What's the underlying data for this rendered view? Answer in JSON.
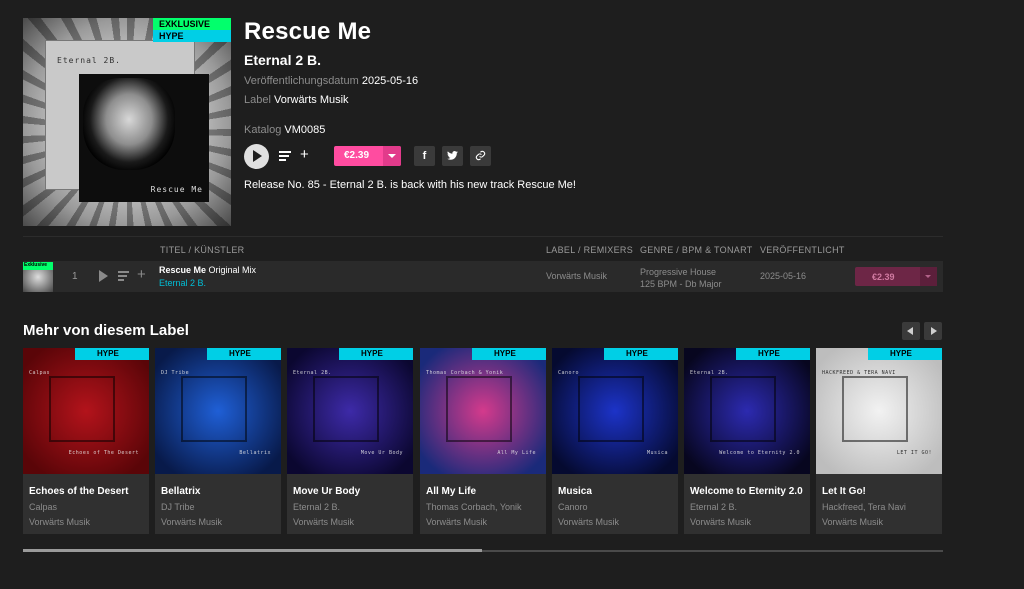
{
  "release": {
    "title": "Rescue Me",
    "artist": "Eternal 2 B.",
    "badges": {
      "exclusive": "EXKLUSIVE",
      "hype": "HYPE"
    },
    "cover_text": {
      "artist": "Eternal 2B.",
      "title": "Rescue Me"
    },
    "release_date_label": "Veröffentlichungsdatum",
    "release_date": "2025-05-16",
    "label_label": "Label",
    "label": "Vorwärts Musik",
    "catalog_label": "Katalog",
    "catalog": "VM0085",
    "price": "€2.39",
    "description": "Release No. 85 - Eternal 2 B. is back with his new track Rescue Me!",
    "social": {
      "facebook": "f",
      "twitter": "t"
    }
  },
  "track_table": {
    "headers": {
      "title_artist": "TITEL / KÜNSTLER",
      "label_remixers": "LABEL / REMIXERS",
      "genre_bpm_key": "GENRE / BPM & TONART",
      "released": "VERÖFFENTLICHT"
    },
    "rows": [
      {
        "badge": "Exklusive",
        "number": "1",
        "title": "Rescue Me",
        "mix": "Original Mix",
        "artist": "Eternal 2 B.",
        "label": "Vorwärts Musik",
        "genre": "Progressive House",
        "bpm_key": "125 BPM - Db Major",
        "date": "2025-05-16",
        "price": "€2.39"
      }
    ]
  },
  "more_from_label": {
    "title": "Mehr von diesem Label",
    "cards": [
      {
        "title": "Echoes of the Desert",
        "artist": "Calpas",
        "label": "Vorwärts Musik",
        "badge": "HYPE",
        "art_text_top": "Calpas",
        "art_text_bottom": "Echoes of The Desert",
        "colors": [
          "#b3131b",
          "#5a0508"
        ]
      },
      {
        "title": "Bellatrix",
        "artist": "DJ Tribe",
        "label": "Vorwärts Musik",
        "badge": "HYPE",
        "art_text_top": "DJ Tribe",
        "art_text_bottom": "Bellatrix",
        "colors": [
          "#1f5fd6",
          "#081a4a"
        ]
      },
      {
        "title": "Move Ur Body",
        "artist": "Eternal 2 B.",
        "label": "Vorwärts Musik",
        "badge": "HYPE",
        "art_text_top": "Eternal 2B.",
        "art_text_bottom": "Move Ur Body",
        "colors": [
          "#3d2aa8",
          "#0b0730"
        ]
      },
      {
        "title": "All My Life",
        "artist": "Thomas Corbach, Yonik",
        "label": "Vorwärts Musik",
        "badge": "HYPE",
        "art_text_top": "Thomas Corbach & Yonik",
        "art_text_bottom": "All My Life",
        "colors": [
          "#d43a8c",
          "#1a2a7a"
        ]
      },
      {
        "title": "Musica",
        "artist": "Canoro",
        "label": "Vorwärts Musik",
        "badge": "HYPE",
        "art_text_top": "Canoro",
        "art_text_bottom": "Musica",
        "colors": [
          "#1c33c8",
          "#050a30"
        ]
      },
      {
        "title": "Welcome to Eternity 2.0",
        "artist": "Eternal 2 B.",
        "label": "Vorwärts Musik",
        "badge": "HYPE",
        "art_text_top": "Eternal 2B.",
        "art_text_bottom": "Welcome to Eternity 2.0",
        "colors": [
          "#2c2ab0",
          "#07061f"
        ]
      },
      {
        "title": "Let It Go!",
        "artist": "Hackfreed, Tera Navi",
        "label": "Vorwärts Musik",
        "badge": "HYPE",
        "art_text_top": "HACKFREED & TERA NAVI",
        "art_text_bottom": "LET IT GO!",
        "colors": [
          "#f2f2f2",
          "#bdbdbd"
        ]
      }
    ]
  },
  "colors": {
    "accent_pink": "#ff4ca0",
    "accent_cyan": "#00cfe6",
    "accent_green": "#02ff6c",
    "background": "#1e1e1e"
  }
}
